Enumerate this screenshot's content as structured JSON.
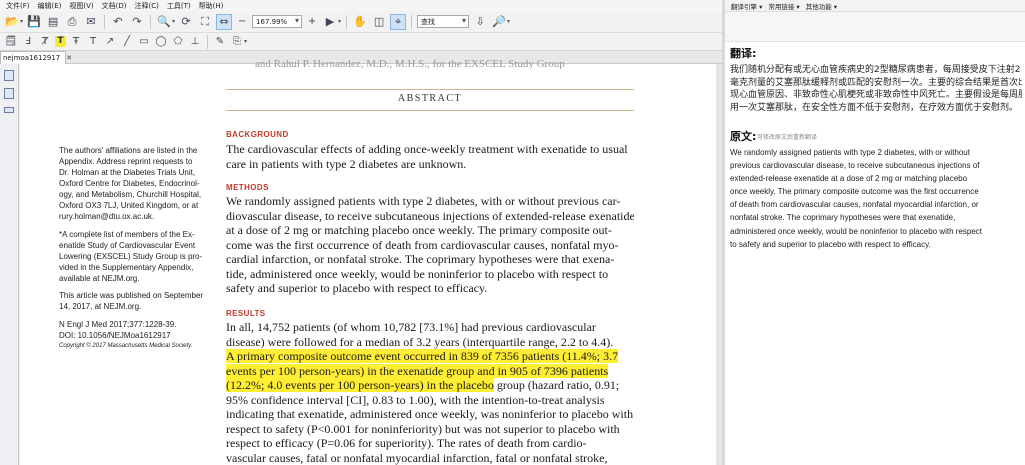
{
  "menubar": {
    "items": [
      "文件(F)",
      "编辑(E)",
      "视图(V)",
      "文档(D)",
      "注释(C)",
      "工具(T)",
      "帮助(H)"
    ]
  },
  "toolbar": {
    "zoom_value": "167.99%",
    "find_placeholder": "查找"
  },
  "tab": {
    "label": "nejmoa1612917",
    "close": "✕"
  },
  "document": {
    "prev_line": "and Rahul P. Hernandez, M.D., M.H.S., for the EXSCEL Study Group",
    "abstract_title": "ABSTRACT",
    "background": {
      "heading": "BACKGROUND",
      "lines": [
        "The cardiovascular effects of adding once-weekly treatment with exenatide to usual",
        "care in patients with type 2 diabetes are unknown."
      ]
    },
    "methods": {
      "heading": "METHODS",
      "lines": [
        "We randomly assigned patients with type 2 diabetes, with or without previous car-",
        "diovascular disease, to receive subcutaneous injections of extended-release exenatide",
        "at a dose of 2 mg or matching placebo once weekly. The primary composite out-",
        "come was the first occurrence of death from cardiovascular causes, nonfatal myo-",
        "cardial infarction, or nonfatal stroke. The coprimary hypotheses were that exena-",
        "tide, administered once weekly, would be noninferior to placebo with respect to",
        "safety and superior to placebo with respect to efficacy."
      ]
    },
    "results": {
      "heading": "RESULTS",
      "line1": "In all, 14,752 patients (of whom 10,782 [73.1%] had previous cardiovascular",
      "line2": "disease) were followed for a median of 3.2 years (interquartile range, 2.2 to 4.4).",
      "hl_line3": "A primary composite outcome event occurred in 839 of 7356 patients (11.4%; 3.7",
      "hl_line4": "events per 100 person-years) in the exenatide group and in 905 of 7396 patients",
      "hl_line5": "(12.2%; 4.0 events per 100 person-years) in the placebo",
      "line5_rest": " group (hazard ratio, 0.91;",
      "line6": "95% confidence interval [CI], 0.83 to 1.00), with the intention-to-treat analysis",
      "line7": "indicating that exenatide, administered once weekly, was noninferior to placebo with",
      "line8": "respect to safety (P<0.001 for noninferiority) but was not superior to placebo with",
      "line9": "respect to efficacy (P=0.06 for superiority). The rates of death from cardio-",
      "line10": "vascular causes, fatal or nonfatal myocardial infarction, fatal or nonfatal stroke,"
    },
    "sidebar_notes": {
      "affiliations": [
        "The authors' affiliations are listed in the",
        "Appendix. Address reprint requests to",
        "Dr. Holman at the Diabetes Trials Unit,",
        "Oxford Centre for Diabetes, Endocrinol-",
        "ogy, and Metabolism, Churchill Hospital,",
        "Oxford OX3 7LJ, United Kingdom, or at",
        "rury.holman@dtu.ox.ac.uk."
      ],
      "members": [
        "*A complete list of members of the Ex-",
        "enatide Study of Cardiovascular Event",
        "Lowering (EXSCEL) Study Group is pro-",
        "vided in the Supplementary Appendix,",
        "available at NEJM.org."
      ],
      "published": [
        "This article was published on September",
        "14, 2017, at NEJM.org."
      ],
      "citation": [
        "N Engl J Med 2017;377:1228-39.",
        "DOI: 10.1056/NEJMoa1612917"
      ],
      "copyright": "Copyright © 2017 Massachusetts Medical Society."
    }
  },
  "translation_panel": {
    "menu": [
      "翻译引擎 ▾",
      "常用链接 ▾",
      "其他功能 ▾"
    ],
    "translation_heading": "翻译:",
    "translation_lines": [
      "我们随机分配有或无心血管疾病史的2型糖尿病患者，每周接受皮下注射2",
      "毫克剂量的艾塞那肽缓释剂或匹配的安慰剂一次。主要的综合结果是首次出",
      "现心血管原因、非致命性心肌梗死或非致命性中风死亡。主要假设是每周服",
      "用一次艾塞那肽，在安全性方面不低于安慰剂，在疗效方面优于安慰剂。"
    ],
    "original_heading": "原文:",
    "original_sub": "可修改原文后重新翻译",
    "original_lines": [
      "We randomly assigned patients with type 2 diabetes, with or without",
      "previous cardiovascular disease, to receive subcutaneous injections of",
      "extended-release exenatide at a dose of 2 mg or matching placebo",
      "once weekly. The primary composite outcome was the first occurrence",
      "of death from cardiovascular causes, nonfatal myocardial infarction, or",
      "nonfatal stroke. The coprimary hypotheses were that exenatide,",
      "administered once weekly, would be noninferior to placebo with respect",
      "to safety and superior to placebo with respect to efficacy."
    ]
  }
}
